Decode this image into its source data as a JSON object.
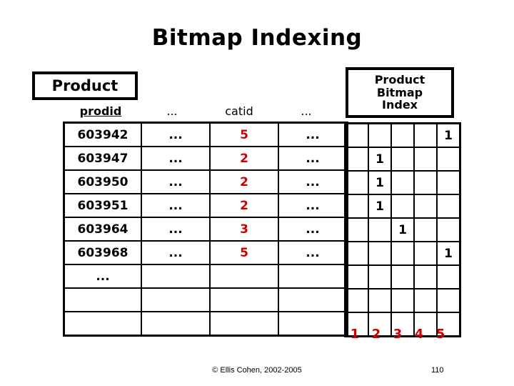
{
  "slide": {
    "title": "Bitmap Indexing"
  },
  "entity_box": {
    "label": "Product"
  },
  "index_box": {
    "lines": [
      "Product",
      "Bitmap",
      "Index"
    ]
  },
  "product_table": {
    "headers": [
      {
        "label": "prodid",
        "primary_key": true
      },
      {
        "label": "...",
        "primary_key": false
      },
      {
        "label": "catid",
        "primary_key": false
      },
      {
        "label": "...",
        "primary_key": false
      }
    ],
    "rows": [
      {
        "prodid": "603942",
        "dots1": "...",
        "catid": "5",
        "dots2": "..."
      },
      {
        "prodid": "603947",
        "dots1": "...",
        "catid": "2",
        "dots2": "..."
      },
      {
        "prodid": "603950",
        "dots1": "...",
        "catid": "2",
        "dots2": "..."
      },
      {
        "prodid": "603951",
        "dots1": "...",
        "catid": "2",
        "dots2": "..."
      },
      {
        "prodid": "603964",
        "dots1": "...",
        "catid": "3",
        "dots2": "..."
      },
      {
        "prodid": "603968",
        "dots1": "...",
        "catid": "5",
        "dots2": "..."
      },
      {
        "prodid": "...",
        "dots1": "",
        "catid": "",
        "dots2": ""
      },
      {
        "prodid": "",
        "dots1": "",
        "catid": "",
        "dots2": ""
      },
      {
        "prodid": "",
        "dots1": "",
        "catid": "",
        "dots2": ""
      }
    ]
  },
  "bitmap_grid": {
    "column_labels": [
      "1",
      "2",
      "3",
      "4",
      "5"
    ],
    "mark": "1",
    "rows": [
      [
        "",
        "",
        "",
        "",
        "1"
      ],
      [
        "",
        "1",
        "",
        "",
        ""
      ],
      [
        "",
        "1",
        "",
        "",
        ""
      ],
      [
        "",
        "1",
        "",
        "",
        ""
      ],
      [
        "",
        "",
        "1",
        "",
        ""
      ],
      [
        "",
        "",
        "",
        "",
        "1"
      ],
      [
        "",
        "",
        "",
        "",
        ""
      ],
      [
        "",
        "",
        "",
        "",
        ""
      ],
      [
        "",
        "",
        "",
        "",
        ""
      ]
    ]
  },
  "footer": {
    "copyright": "© Ellis Cohen, 2002-2005",
    "page_number": "110"
  },
  "colors": {
    "accent_red": "#CC0000",
    "ink": "#000000",
    "background": "#FFFFFF"
  }
}
